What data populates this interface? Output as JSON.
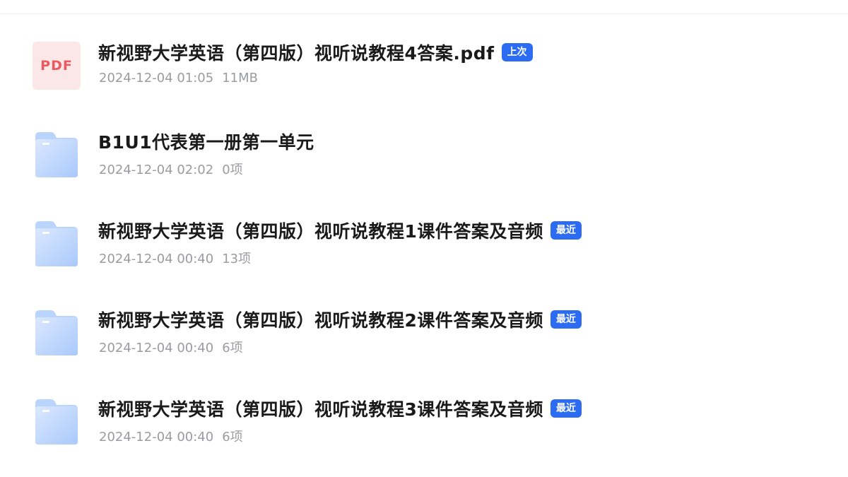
{
  "files": [
    {
      "type": "pdf",
      "icon": "pdf-file-icon",
      "icon_label": "PDF",
      "name": "新视野大学英语（第四版）视听说教程4答案.pdf",
      "badge": "上次",
      "date": "2024-12-04 01:05",
      "size": "11MB"
    },
    {
      "type": "folder",
      "icon": "folder-icon",
      "name": "B1U1代表第一册第一单元",
      "badge": "",
      "date": "2024-12-04 02:02",
      "size": "0项"
    },
    {
      "type": "folder",
      "icon": "folder-icon",
      "name": "新视野大学英语（第四版）视听说教程1课件答案及音频",
      "badge": "最近",
      "date": "2024-12-04 00:40",
      "size": "13项"
    },
    {
      "type": "folder",
      "icon": "folder-icon",
      "name": "新视野大学英语（第四版）视听说教程2课件答案及音频",
      "badge": "最近",
      "date": "2024-12-04 00:40",
      "size": "6项"
    },
    {
      "type": "folder",
      "icon": "folder-icon",
      "name": "新视野大学英语（第四版）视听说教程3课件答案及音频",
      "badge": "最近",
      "date": "2024-12-04 00:40",
      "size": "6项"
    }
  ],
  "colors": {
    "badge_bg": "#2b6cf3",
    "pdf_icon_bg": "#fbe6e8",
    "pdf_icon_text": "#ea5a5f",
    "folder_light": "#cfe1ff",
    "folder_dark": "#9cc2fb",
    "name_text": "#1a1a1a",
    "meta_text": "#9a9ca3"
  }
}
